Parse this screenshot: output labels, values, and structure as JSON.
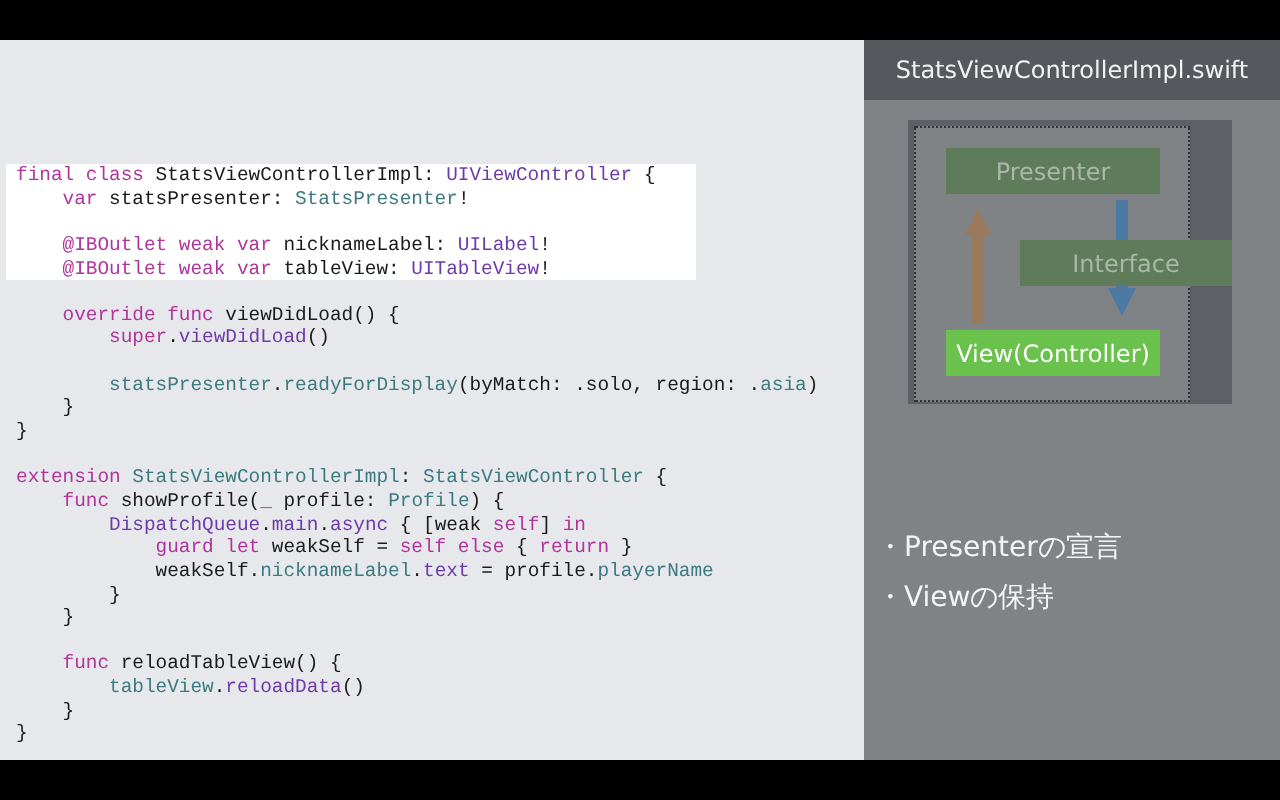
{
  "code": {
    "lines": [
      {
        "highlighted": true,
        "tokens": [
          {
            "kind": "keyword",
            "text": "final class"
          },
          {
            "kind": "plain",
            "text": " StatsViewControllerImpl: "
          },
          {
            "kind": "system",
            "text": "UIViewController"
          },
          {
            "kind": "plain",
            "text": " {"
          }
        ]
      },
      {
        "highlighted": true,
        "tokens": [
          {
            "kind": "keyword",
            "text": "    var"
          },
          {
            "kind": "plain",
            "text": " statsPresenter: "
          },
          {
            "kind": "project",
            "text": "StatsPresenter"
          },
          {
            "kind": "plain",
            "text": "!"
          }
        ]
      },
      {
        "highlighted": true
      },
      {
        "highlighted": true,
        "tokens": [
          {
            "kind": "keyword",
            "text": "    @IBOutlet weak var"
          },
          {
            "kind": "plain",
            "text": " nicknameLabel: "
          },
          {
            "kind": "system",
            "text": "UILabel"
          },
          {
            "kind": "plain",
            "text": "!"
          }
        ]
      },
      {
        "highlighted": true,
        "tokens": [
          {
            "kind": "keyword",
            "text": "    @IBOutlet weak var"
          },
          {
            "kind": "plain",
            "text": " tableView: "
          },
          {
            "kind": "system",
            "text": "UITableView"
          },
          {
            "kind": "plain",
            "text": "!"
          }
        ]
      },
      {
        "highlighted": false
      },
      {
        "highlighted": false,
        "tokens": [
          {
            "kind": "keyword",
            "text": "    override func"
          },
          {
            "kind": "plain",
            "text": " viewDidLoad() {"
          }
        ]
      },
      {
        "highlighted": false,
        "tokens": [
          {
            "kind": "keyword",
            "text": "        super"
          },
          {
            "kind": "plain",
            "text": "."
          },
          {
            "kind": "system",
            "text": "viewDidLoad"
          },
          {
            "kind": "plain",
            "text": "()"
          }
        ]
      },
      {
        "highlighted": false
      },
      {
        "highlighted": false,
        "tokens": [
          {
            "kind": "project",
            "text": "        statsPresenter"
          },
          {
            "kind": "plain",
            "text": "."
          },
          {
            "kind": "project",
            "text": "readyForDisplay"
          },
          {
            "kind": "plain",
            "text": "(byMatch: .solo, region: ."
          },
          {
            "kind": "project",
            "text": "asia"
          },
          {
            "kind": "plain",
            "text": ")"
          }
        ]
      },
      {
        "highlighted": false,
        "tokens": [
          {
            "kind": "plain",
            "text": "    }"
          }
        ]
      },
      {
        "highlighted": false,
        "tokens": [
          {
            "kind": "plain",
            "text": "}"
          }
        ]
      },
      {
        "highlighted": false
      },
      {
        "highlighted": false,
        "tokens": [
          {
            "kind": "keyword",
            "text": "extension"
          },
          {
            "kind": "project",
            "text": " StatsViewControllerImpl"
          },
          {
            "kind": "plain",
            "text": ": "
          },
          {
            "kind": "project",
            "text": "StatsViewController"
          },
          {
            "kind": "plain",
            "text": " {"
          }
        ]
      },
      {
        "highlighted": false,
        "tokens": [
          {
            "kind": "keyword",
            "text": "    func"
          },
          {
            "kind": "plain",
            "text": " showProfile("
          },
          {
            "kind": "keyword",
            "text": "_"
          },
          {
            "kind": "plain",
            "text": " profile: "
          },
          {
            "kind": "project",
            "text": "Profile"
          },
          {
            "kind": "plain",
            "text": ") {"
          }
        ]
      },
      {
        "highlighted": false,
        "tokens": [
          {
            "kind": "system",
            "text": "        DispatchQueue"
          },
          {
            "kind": "plain",
            "text": "."
          },
          {
            "kind": "system",
            "text": "main"
          },
          {
            "kind": "plain",
            "text": "."
          },
          {
            "kind": "system",
            "text": "async"
          },
          {
            "kind": "plain",
            "text": " { [weak "
          },
          {
            "kind": "keyword",
            "text": "self"
          },
          {
            "kind": "plain",
            "text": "] "
          },
          {
            "kind": "keyword",
            "text": "in"
          }
        ]
      },
      {
        "highlighted": false,
        "tokens": [
          {
            "kind": "keyword",
            "text": "            guard let"
          },
          {
            "kind": "plain",
            "text": " weakSelf = "
          },
          {
            "kind": "keyword",
            "text": "self else"
          },
          {
            "kind": "plain",
            "text": " { "
          },
          {
            "kind": "keyword",
            "text": "return"
          },
          {
            "kind": "plain",
            "text": " }"
          }
        ]
      },
      {
        "highlighted": false,
        "tokens": [
          {
            "kind": "plain",
            "text": "            weakSelf."
          },
          {
            "kind": "project",
            "text": "nicknameLabel"
          },
          {
            "kind": "plain",
            "text": "."
          },
          {
            "kind": "system",
            "text": "text"
          },
          {
            "kind": "plain",
            "text": " = profile."
          },
          {
            "kind": "project",
            "text": "playerName"
          }
        ]
      },
      {
        "highlighted": false,
        "tokens": [
          {
            "kind": "plain",
            "text": "        }"
          }
        ]
      },
      {
        "highlighted": false,
        "tokens": [
          {
            "kind": "plain",
            "text": "    }"
          }
        ]
      },
      {
        "highlighted": false
      },
      {
        "highlighted": false,
        "tokens": [
          {
            "kind": "keyword",
            "text": "    func"
          },
          {
            "kind": "plain",
            "text": " reloadTableView() {"
          }
        ]
      },
      {
        "highlighted": false,
        "tokens": [
          {
            "kind": "project",
            "text": "        tableView"
          },
          {
            "kind": "plain",
            "text": "."
          },
          {
            "kind": "system",
            "text": "reloadData"
          },
          {
            "kind": "plain",
            "text": "()"
          }
        ]
      },
      {
        "highlighted": false,
        "tokens": [
          {
            "kind": "plain",
            "text": "    }"
          }
        ]
      },
      {
        "highlighted": false,
        "tokens": [
          {
            "kind": "plain",
            "text": "}"
          }
        ]
      }
    ]
  },
  "side_panel": {
    "title": "StatsViewControllerImpl.swift",
    "diagram": {
      "presenter": "Presenter",
      "interface": "Interface",
      "view": "View(Controller)"
    },
    "points": [
      "・Presenterの宣言",
      "・Viewの保持"
    ]
  }
}
